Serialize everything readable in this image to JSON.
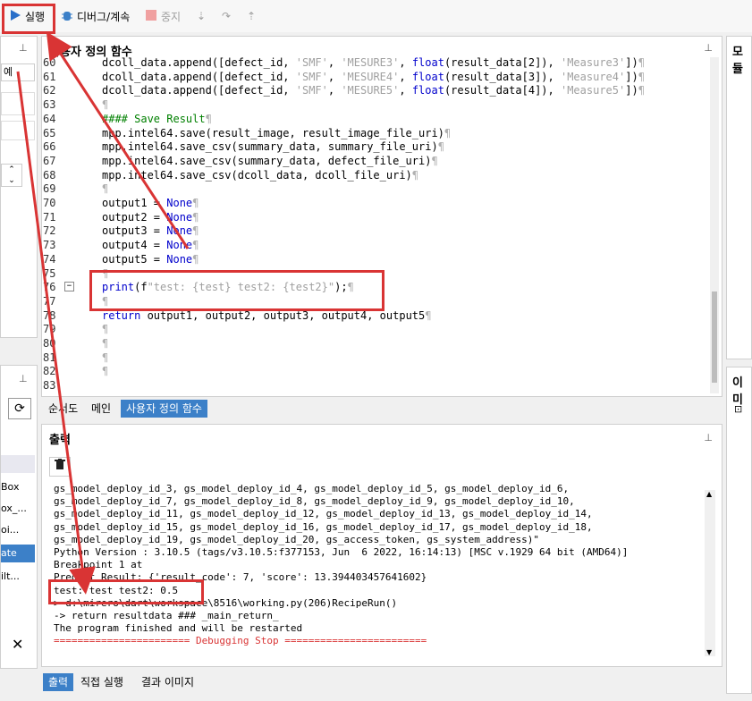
{
  "toolbar": {
    "run_label": "실행",
    "debug_label": "디버그/계속",
    "stop_label": "중지"
  },
  "editor_panel": {
    "title": "사용자 정의 함수"
  },
  "right_panel_top": {
    "title": "모듈"
  },
  "right_panel_bottom": {
    "title": "이미"
  },
  "left_panel": {
    "top_field": "예",
    "items": [
      "Box",
      "ox_...",
      "oi...",
      "ate",
      "ilt..."
    ]
  },
  "code_lines": [
    {
      "num": "60",
      "html": "dcoll_data.append([defect_id, <s>'SMF'</s>, <s>'MESURE3'</s>, <k>float</k>(result_data[2]), <s>'Measure3'</s>])<g>¶</g>"
    },
    {
      "num": "61",
      "html": "dcoll_data.append([defect_id, <s>'SMF'</s>, <s>'MESURE4'</s>, <k>float</k>(result_data[3]), <s>'Measure4'</s>])<g>¶</g>"
    },
    {
      "num": "62",
      "html": "dcoll_data.append([defect_id, <s>'SMF'</s>, <s>'MESURE5'</s>, <k>float</k>(result_data[4]), <s>'Measure5'</s>])<g>¶</g>"
    },
    {
      "num": "63",
      "html": "<g>¶</g>"
    },
    {
      "num": "64",
      "html": "<c>#### Save Result</c><g>¶</g>"
    },
    {
      "num": "65",
      "html": "mpp.intel64.save(result_image, result_image_file_uri)<g>¶</g>"
    },
    {
      "num": "66",
      "html": "mpp.intel64.save_csv(summary_data, summary_file_uri)<g>¶</g>"
    },
    {
      "num": "67",
      "html": "mpp.intel64.save_csv(summary_data, defect_file_uri)<g>¶</g>"
    },
    {
      "num": "68",
      "html": "mpp.intel64.save_csv(dcoll_data, dcoll_file_uri)<g>¶</g>"
    },
    {
      "num": "69",
      "html": "<g>¶</g>"
    },
    {
      "num": "70",
      "html": "output1 = <k>None</k><g>¶</g>"
    },
    {
      "num": "71",
      "html": "output2 = <k>None</k><g>¶</g>"
    },
    {
      "num": "72",
      "html": "output3 = <k>None</k><g>¶</g>"
    },
    {
      "num": "73",
      "html": "output4 = <k>None</k><g>¶</g>"
    },
    {
      "num": "74",
      "html": "output5 = <k>None</k><g>¶</g>"
    },
    {
      "num": "75",
      "html": "<g>¶</g>"
    },
    {
      "num": "76",
      "html": "<k>print</k>(f<s>\"test: {test} test2: {test2}\"</s>);<g>¶</g>"
    },
    {
      "num": "77",
      "html": "<g>¶</g>"
    },
    {
      "num": "78",
      "html": "<k>return</k> output1, output2, output3, output4, output5<g>¶</g>"
    },
    {
      "num": "79",
      "html": "<g>¶</g>"
    },
    {
      "num": "80",
      "html": "<g>¶</g>"
    },
    {
      "num": "81",
      "html": "<g>¶</g>"
    },
    {
      "num": "82",
      "html": "<g>¶</g>"
    },
    {
      "num": "83",
      "html": ""
    }
  ],
  "editor_tabs": [
    "순서도",
    "메인",
    "사용자 정의 함수"
  ],
  "output_panel": {
    "title": "출력"
  },
  "output_lines": [
    "gs_model_deploy_id_3, gs_model_deploy_id_4, gs_model_deploy_id_5, gs_model_deploy_id_6,",
    "gs_model_deploy_id_7, gs_model_deploy_id_8, gs_model_deploy_id_9, gs_model_deploy_id_10,",
    "gs_model_deploy_id_11, gs_model_deploy_id_12, gs_model_deploy_id_13, gs_model_deploy_id_14,",
    "gs_model_deploy_id_15, gs_model_deploy_id_16, gs_model_deploy_id_17, gs_model_deploy_id_18,",
    "gs_model_deploy_id_19, gs_model_deploy_id_20, gs_access_token, gs_system_address)\"",
    "Python Version : 3.10.5 (tags/v3.10.5:f377153, Jun  6 2022, 16:14:13) [MSC v.1929 64 bit (AMD64)]",
    "Breakpoint 1 at",
    "Predict Result: {'result_code': 7, 'score': 13.394403457641602}",
    "test: test test2: 0.5",
    "> d:\\mirero\\dart\\workspace\\8516\\working.py(206)RecipeRun()",
    "-> return resultdata ### _main_return_",
    "The program finished and will be restarted",
    "======================= Debugging Stop ========================"
  ],
  "bottom_tabs": [
    "출력",
    "직접 실행",
    "결과 이미지"
  ],
  "colors": {
    "accent": "#3c80c8",
    "annotation": "#d93434",
    "keyword": "#0000cc",
    "comment": "#008000",
    "stop_text": "#d93434"
  }
}
